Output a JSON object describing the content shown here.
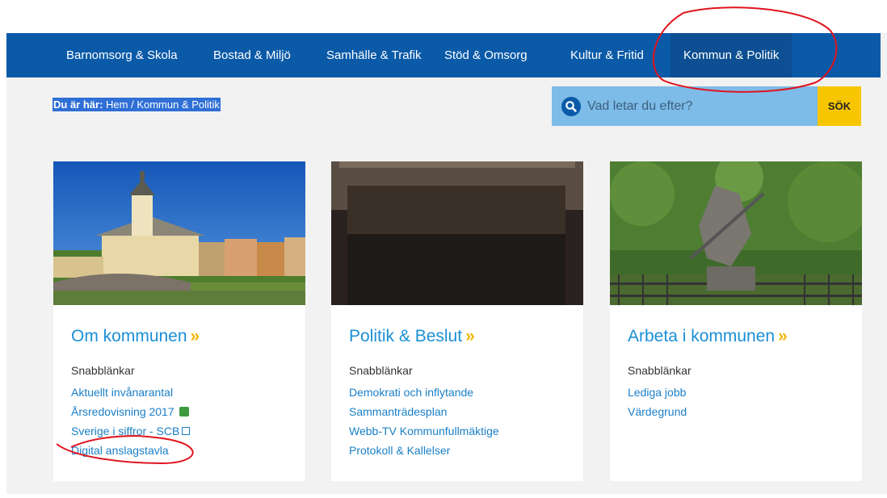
{
  "nav": {
    "items": [
      {
        "label": "Barnomsorg & Skola"
      },
      {
        "label": "Bostad & Miljö"
      },
      {
        "label": "Samhälle & Trafik"
      },
      {
        "label": "Stöd & Omsorg"
      },
      {
        "label": "Kultur & Fritid"
      },
      {
        "label": "Kommun & Politik"
      }
    ]
  },
  "breadcrumb": {
    "prefix": "Du är här:",
    "path": "Hem / Kommun & Politik"
  },
  "search": {
    "placeholder": "Vad letar du efter?",
    "button": "SÖK"
  },
  "cards": [
    {
      "title": "Om kommunen",
      "chevron": "»",
      "quicklinks_label": "Snabblänkar",
      "links": [
        "Aktuellt invånarantal",
        "Årsredovisning 2017",
        "Sverige i siffror - SCB",
        "Digital anslagstavla"
      ]
    },
    {
      "title": "Politik & Beslut",
      "chevron": "»",
      "quicklinks_label": "Snabblänkar",
      "links": [
        "Demokrati och inflytande",
        "Sammanträdesplan",
        "Webb-TV Kommunfullmäktige",
        "Protokoll & Kallelser"
      ]
    },
    {
      "title": "Arbeta i kommunen",
      "chevron": "»",
      "quicklinks_label": "Snabblänkar",
      "links": [
        "Lediga jobb",
        "Värdegrund"
      ]
    }
  ],
  "colors": {
    "nav_bg": "#0a5aa8",
    "nav_active": "#0d4f92",
    "link": "#1a7fc7",
    "title": "#1a8fd6",
    "search_bg": "#7dbbe8",
    "search_button": "#f7c600",
    "annotation": "#e0141e"
  }
}
